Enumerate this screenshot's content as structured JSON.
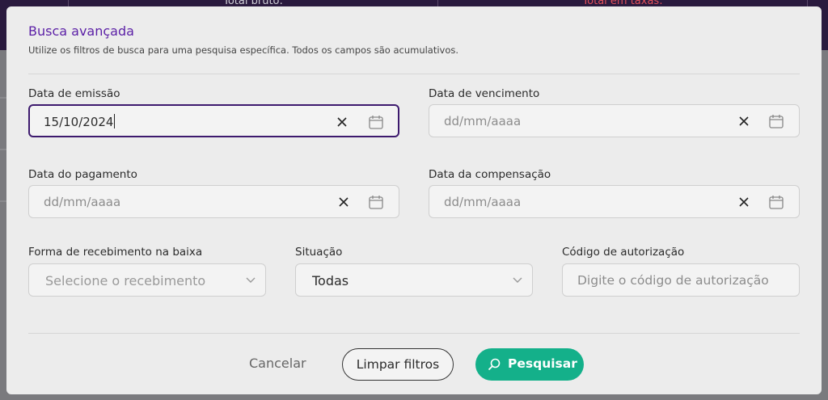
{
  "background": {
    "header_cells": [
      "Total bruto:",
      "Total em taxas:"
    ]
  },
  "modal": {
    "title": "Busca avançada",
    "subtitle": "Utilize os filtros de busca para uma pesquisa específica. Todos os campos são acumulativos."
  },
  "fields": {
    "emissao": {
      "label": "Data de emissão",
      "value": "15/10/2024",
      "placeholder": "dd/mm/aaaa"
    },
    "vencimento": {
      "label": "Data de vencimento",
      "value": "",
      "placeholder": "dd/mm/aaaa"
    },
    "pagamento": {
      "label": "Data do pagamento",
      "value": "",
      "placeholder": "dd/mm/aaaa"
    },
    "compensacao": {
      "label": "Data da compensação",
      "value": "",
      "placeholder": "dd/mm/aaaa"
    },
    "recebimento": {
      "label": "Forma de recebimento na baixa",
      "placeholder": "Selecione o recebimento"
    },
    "situacao": {
      "label": "Situação",
      "value": "Todas"
    },
    "autorizacao": {
      "label": "Código de autorização",
      "placeholder": "Digite o código de autorização"
    }
  },
  "buttons": {
    "cancel": "Cancelar",
    "clear": "Limpar filtros",
    "search": "Pesquisar"
  },
  "colors": {
    "accent_title": "#5b1fa6",
    "focus_border": "#3d1a6e",
    "search_button": "#14b08a"
  },
  "icons": {
    "clear": "close-icon",
    "date": "calendar-icon",
    "select": "chevron-down-icon",
    "search": "search-icon"
  }
}
